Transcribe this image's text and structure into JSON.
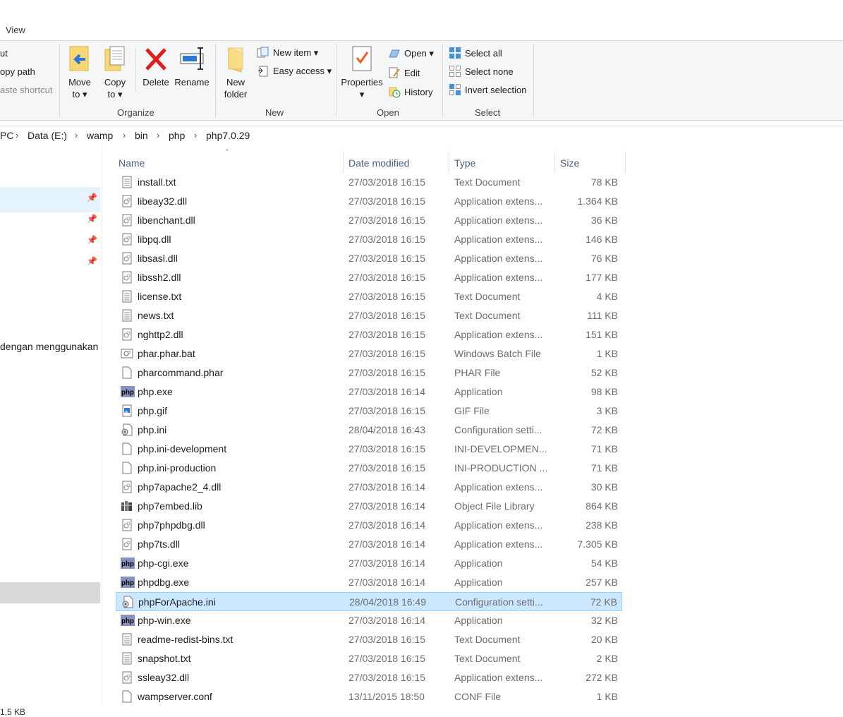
{
  "topbar": {
    "tab_view": "View"
  },
  "ribbon": {
    "clipboard": {
      "cut": "ut",
      "copy_path": "opy path",
      "paste_shortcut": "aste shortcut"
    },
    "organize": {
      "label": "Organize",
      "move_to_1": "Move",
      "move_to_2": "to ▾",
      "copy_to_1": "Copy",
      "copy_to_2": "to ▾",
      "delete": "Delete",
      "rename": "Rename"
    },
    "new": {
      "label": "New",
      "new_folder_1": "New",
      "new_folder_2": "folder",
      "new_item": "New item ▾",
      "easy_access": "Easy access ▾"
    },
    "open": {
      "label": "Open",
      "properties": "Properties",
      "open": "Open ▾",
      "edit": "Edit",
      "history": "History"
    },
    "select": {
      "label": "Select",
      "select_all": "Select all",
      "select_none": "Select none",
      "invert_selection": "Invert selection"
    }
  },
  "address": {
    "crumbs": [
      "PC",
      "Data (E:)",
      "wamp",
      "bin",
      "php",
      "php7.0.29"
    ]
  },
  "left_pane": {
    "text": "dengan menggunakan",
    "size": "1,5 KB"
  },
  "columns": {
    "name": "Name",
    "date": "Date modified",
    "type": "Type",
    "size": "Size"
  },
  "files": [
    {
      "name": "install.txt",
      "date": "27/03/2018 16:15",
      "type": "Text Document",
      "size": "78 KB",
      "icon": "text-file-icon"
    },
    {
      "name": "libeay32.dll",
      "date": "27/03/2018 16:15",
      "type": "Application extens...",
      "size": "1.364 KB",
      "icon": "dll-file-icon"
    },
    {
      "name": "libenchant.dll",
      "date": "27/03/2018 16:15",
      "type": "Application extens...",
      "size": "36 KB",
      "icon": "dll-file-icon"
    },
    {
      "name": "libpq.dll",
      "date": "27/03/2018 16:15",
      "type": "Application extens...",
      "size": "146 KB",
      "icon": "dll-file-icon"
    },
    {
      "name": "libsasl.dll",
      "date": "27/03/2018 16:15",
      "type": "Application extens...",
      "size": "76 KB",
      "icon": "dll-file-icon"
    },
    {
      "name": "libssh2.dll",
      "date": "27/03/2018 16:15",
      "type": "Application extens...",
      "size": "177 KB",
      "icon": "dll-file-icon"
    },
    {
      "name": "license.txt",
      "date": "27/03/2018 16:15",
      "type": "Text Document",
      "size": "4 KB",
      "icon": "text-file-icon"
    },
    {
      "name": "news.txt",
      "date": "27/03/2018 16:15",
      "type": "Text Document",
      "size": "111 KB",
      "icon": "text-file-icon"
    },
    {
      "name": "nghttp2.dll",
      "date": "27/03/2018 16:15",
      "type": "Application extens...",
      "size": "151 KB",
      "icon": "dll-file-icon"
    },
    {
      "name": "phar.phar.bat",
      "date": "27/03/2018 16:15",
      "type": "Windows Batch File",
      "size": "1 KB",
      "icon": "batch-file-icon"
    },
    {
      "name": "pharcommand.phar",
      "date": "27/03/2018 16:15",
      "type": "PHAR File",
      "size": "52 KB",
      "icon": "blank-file-icon"
    },
    {
      "name": "php.exe",
      "date": "27/03/2018 16:14",
      "type": "Application",
      "size": "98 KB",
      "icon": "php-app-icon"
    },
    {
      "name": "php.gif",
      "date": "27/03/2018 16:15",
      "type": "GIF File",
      "size": "3 KB",
      "icon": "image-file-icon"
    },
    {
      "name": "php.ini",
      "date": "28/04/2018 16:43",
      "type": "Configuration setti...",
      "size": "72 KB",
      "icon": "config-file-icon"
    },
    {
      "name": "php.ini-development",
      "date": "27/03/2018 16:15",
      "type": "INI-DEVELOPMEN...",
      "size": "71 KB",
      "icon": "blank-file-icon"
    },
    {
      "name": "php.ini-production",
      "date": "27/03/2018 16:15",
      "type": "INI-PRODUCTION ...",
      "size": "71 KB",
      "icon": "blank-file-icon"
    },
    {
      "name": "php7apache2_4.dll",
      "date": "27/03/2018 16:14",
      "type": "Application extens...",
      "size": "30 KB",
      "icon": "dll-file-icon"
    },
    {
      "name": "php7embed.lib",
      "date": "27/03/2018 16:14",
      "type": "Object File Library",
      "size": "864 KB",
      "icon": "library-file-icon"
    },
    {
      "name": "php7phpdbg.dll",
      "date": "27/03/2018 16:14",
      "type": "Application extens...",
      "size": "238 KB",
      "icon": "dll-file-icon"
    },
    {
      "name": "php7ts.dll",
      "date": "27/03/2018 16:14",
      "type": "Application extens...",
      "size": "7.305 KB",
      "icon": "dll-file-icon"
    },
    {
      "name": "php-cgi.exe",
      "date": "27/03/2018 16:14",
      "type": "Application",
      "size": "54 KB",
      "icon": "php-app-icon"
    },
    {
      "name": "phpdbg.exe",
      "date": "27/03/2018 16:14",
      "type": "Application",
      "size": "257 KB",
      "icon": "php-app-icon"
    },
    {
      "name": "phpForApache.ini",
      "date": "28/04/2018 16:49",
      "type": "Configuration setti...",
      "size": "72 KB",
      "icon": "config-file-icon",
      "selected": true
    },
    {
      "name": "php-win.exe",
      "date": "27/03/2018 16:14",
      "type": "Application",
      "size": "32 KB",
      "icon": "php-app-icon"
    },
    {
      "name": "readme-redist-bins.txt",
      "date": "27/03/2018 16:15",
      "type": "Text Document",
      "size": "20 KB",
      "icon": "text-file-icon"
    },
    {
      "name": "snapshot.txt",
      "date": "27/03/2018 16:15",
      "type": "Text Document",
      "size": "2 KB",
      "icon": "text-file-icon"
    },
    {
      "name": "ssleay32.dll",
      "date": "27/03/2018 16:15",
      "type": "Application extens...",
      "size": "272 KB",
      "icon": "dll-file-icon"
    },
    {
      "name": "wampserver.conf",
      "date": "13/11/2015 18:50",
      "type": "CONF File",
      "size": "1 KB",
      "icon": "blank-file-icon"
    }
  ]
}
